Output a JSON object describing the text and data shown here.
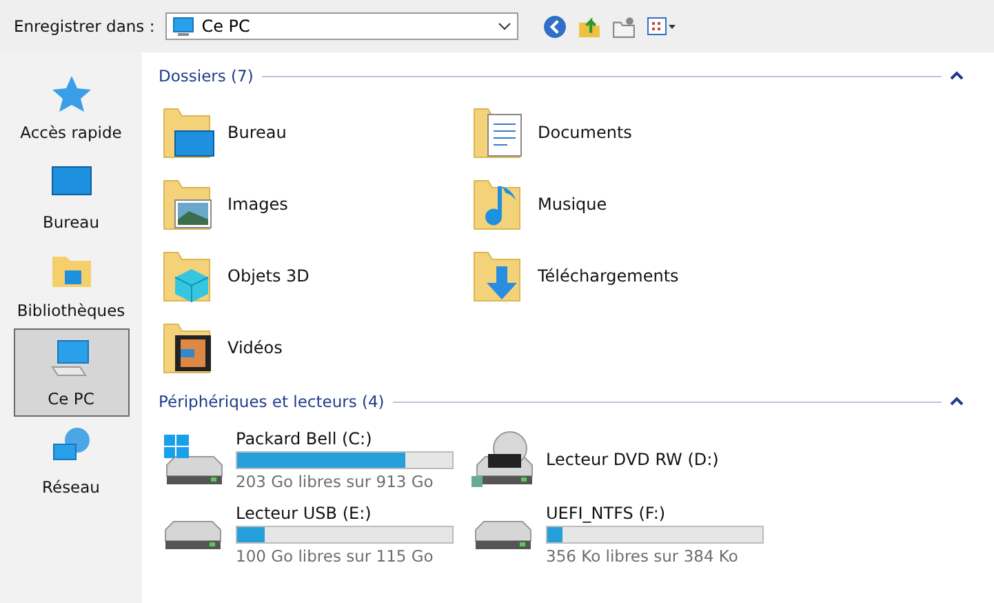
{
  "toolbar": {
    "label": "Enregistrer dans :",
    "location": "Ce PC"
  },
  "sidebar": {
    "items": [
      {
        "label": "Accès rapide",
        "kind": "star",
        "selected": false
      },
      {
        "label": "Bureau",
        "kind": "desktop",
        "selected": false
      },
      {
        "label": "Bibliothèques",
        "kind": "library",
        "selected": false
      },
      {
        "label": "Ce PC",
        "kind": "pc",
        "selected": true
      },
      {
        "label": "Réseau",
        "kind": "network",
        "selected": false
      }
    ]
  },
  "folders_section": {
    "title": "Dossiers (7)",
    "expanded": true,
    "items": [
      {
        "label": "Bureau",
        "kind": "desktop"
      },
      {
        "label": "Documents",
        "kind": "documents"
      },
      {
        "label": "Images",
        "kind": "images"
      },
      {
        "label": "Musique",
        "kind": "music"
      },
      {
        "label": "Objets 3D",
        "kind": "objects3d"
      },
      {
        "label": "Téléchargements",
        "kind": "downloads"
      },
      {
        "label": "Vidéos",
        "kind": "videos"
      }
    ]
  },
  "drives_section": {
    "title": "Périphériques et lecteurs (4)",
    "expanded": true,
    "items": [
      {
        "label": "Packard Bell (C:)",
        "kind": "system",
        "level": 0.78,
        "free": "203 Go libres sur 913 Go"
      },
      {
        "label": "Lecteur DVD RW (D:)",
        "kind": "dvd"
      },
      {
        "label": "Lecteur USB (E:)",
        "kind": "disk",
        "level": 0.13,
        "free": "100 Go libres sur 115 Go"
      },
      {
        "label": "UEFI_NTFS (F:)",
        "kind": "disk",
        "level": 0.07,
        "free": "356 Ko libres sur 384 Ko"
      }
    ]
  }
}
